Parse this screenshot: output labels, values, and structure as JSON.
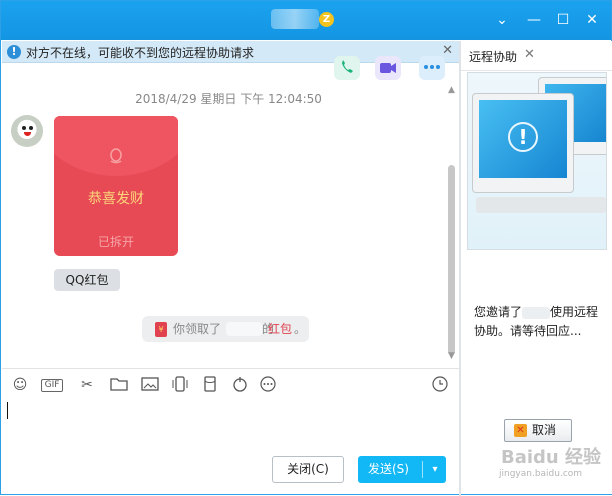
{
  "window": {
    "title_badge": "Z"
  },
  "notice": {
    "text": "对方不在线，可能收不到您的远程协助请求"
  },
  "chat": {
    "timestamp": "2018/4/29 星期日 下午 12:04:50",
    "red_packet": {
      "greeting": "恭喜发财",
      "status": "已拆开"
    },
    "tag": "QQ红包",
    "system": {
      "prefix": "你领取了",
      "mid": "的",
      "link": "红包",
      "end": "。"
    }
  },
  "buttons": {
    "close": "关闭(C)",
    "send": "发送(S)"
  },
  "toolbar": {
    "gif": "GIF"
  },
  "remote": {
    "tab": "远程协助",
    "msg_a": "您邀请了",
    "msg_b": "使用远程协助。请等待回应...",
    "cancel": "取消"
  },
  "watermark": {
    "line1": "Baidu 经验",
    "line2": "jingyan.baidu.com"
  },
  "colors": {
    "titlebar": "#1ba2ef",
    "send": "#12b7f5",
    "red_packet": "#e84a55"
  }
}
